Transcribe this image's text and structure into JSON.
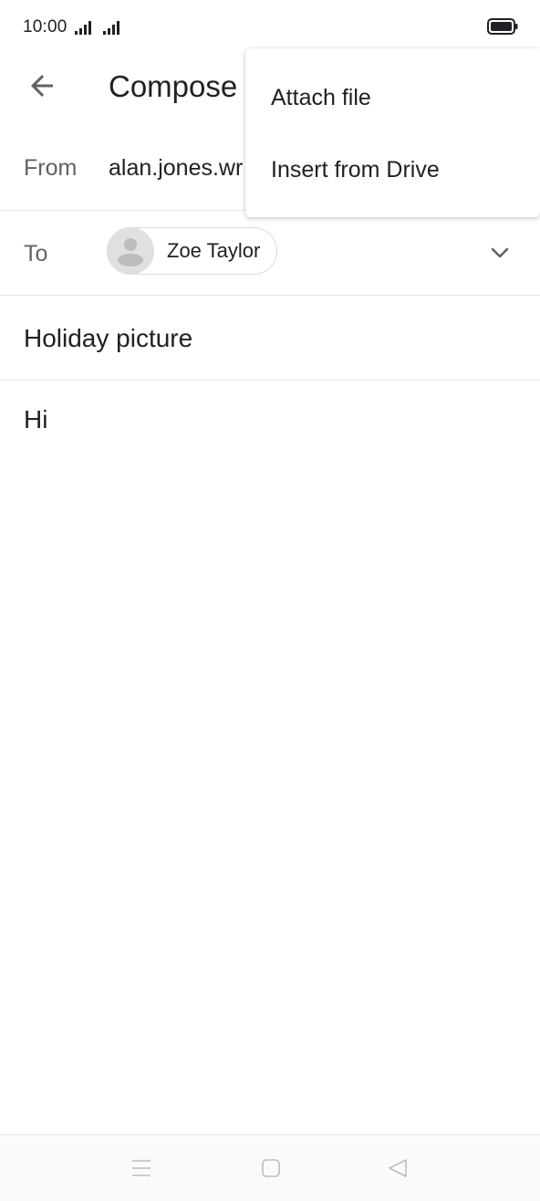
{
  "status_bar": {
    "time": "10:00"
  },
  "app_bar": {
    "title": "Compose"
  },
  "compose": {
    "from_label": "From",
    "from_value": "alan.jones.wr",
    "to_label": "To",
    "recipient_name": "Zoe Taylor",
    "subject": "Holiday picture",
    "body": "Hi"
  },
  "overflow_menu": {
    "items": [
      {
        "label": "Attach file"
      },
      {
        "label": "Insert from Drive"
      }
    ]
  },
  "icons": {
    "back": "arrow-back-icon",
    "expand": "chevron-down-icon",
    "nav_menu": "menu-lines-icon",
    "nav_home": "square-home-icon",
    "nav_back": "triangle-back-icon"
  },
  "colors": {
    "text_primary": "#202124",
    "text_secondary": "#5f6368",
    "divider": "#e6e6e6",
    "chip_border": "#dadce0",
    "avatar_bg": "#e0e0e0"
  }
}
